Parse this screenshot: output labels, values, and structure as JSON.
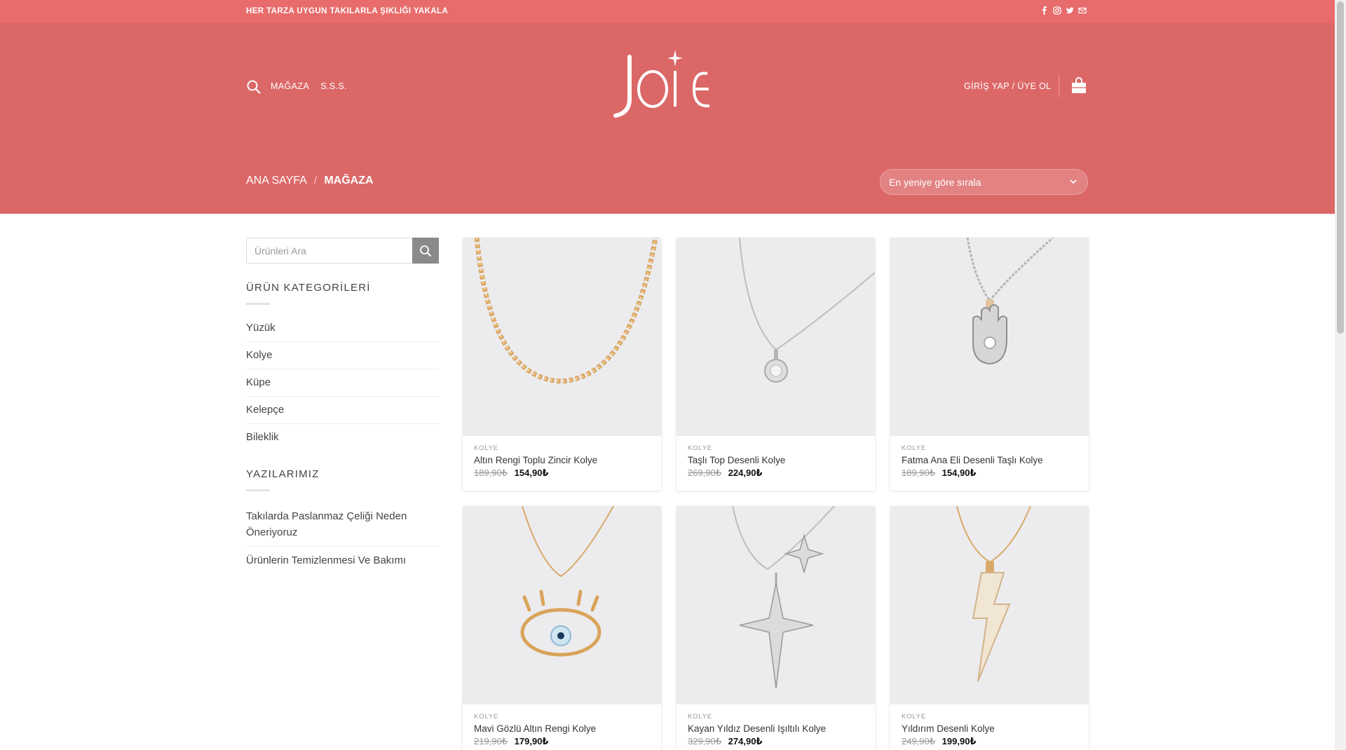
{
  "topbar": {
    "message": "HER TARZA UYGUN TAKILARLA ŞIKLIĞI YAKALA",
    "social_icons": [
      "facebook-icon",
      "instagram-icon",
      "twitter-icon",
      "email-icon"
    ]
  },
  "header": {
    "logo_text": "JOIE",
    "nav": [
      {
        "label": "MAĞAZA"
      },
      {
        "label": "S.S.S."
      }
    ],
    "login_label": "GİRİŞ YAP / ÜYE OL",
    "breadcrumb": {
      "home": "ANA SAYFA",
      "separator": "/",
      "current": "MAĞAZA"
    },
    "sort_selected": "En yeniye göre sırala"
  },
  "sidebar": {
    "search_placeholder": "Ürünleri Ara",
    "categories_heading": "ÜRÜN KATEGORİLERİ",
    "categories": [
      {
        "label": "Yüzük"
      },
      {
        "label": "Kolye"
      },
      {
        "label": "Küpe"
      },
      {
        "label": "Kelepçe"
      },
      {
        "label": "Bileklik"
      }
    ],
    "posts_heading": "YAZILARIMIZ",
    "posts": [
      {
        "label": "Takılarda Paslanmaz Çeliği Neden Öneriyoruz"
      },
      {
        "label": "Ürünlerin Temizlenmesi Ve Bakımı"
      }
    ]
  },
  "products": [
    {
      "category": "KOLYE",
      "name": "Altın Rengi Toplu Zincir Kolye",
      "old_price": "189,90₺",
      "new_price": "154,90₺"
    },
    {
      "category": "KOLYE",
      "name": "Taşlı Top Desenli Kolye",
      "old_price": "269,90₺",
      "new_price": "224,90₺"
    },
    {
      "category": "KOLYE",
      "name": "Fatma Ana Eli Desenli Taşlı Kolye",
      "old_price": "189,90₺",
      "new_price": "154,90₺"
    },
    {
      "category": "KOLYE",
      "name": "Mavi Gözlü Altın Rengi Kolye",
      "old_price": "219,90₺",
      "new_price": "179,90₺"
    },
    {
      "category": "KOLYE",
      "name": "Kayan Yıldız Desenli Işıltılı Kolye",
      "old_price": "329,90₺",
      "new_price": "274,90₺"
    },
    {
      "category": "KOLYE",
      "name": "Yıldırım Desenli Kolye",
      "old_price": "249,90₺",
      "new_price": "199,90₺"
    }
  ],
  "colors": {
    "brand": "#dc6767",
    "topbar": "#e86c6c"
  }
}
